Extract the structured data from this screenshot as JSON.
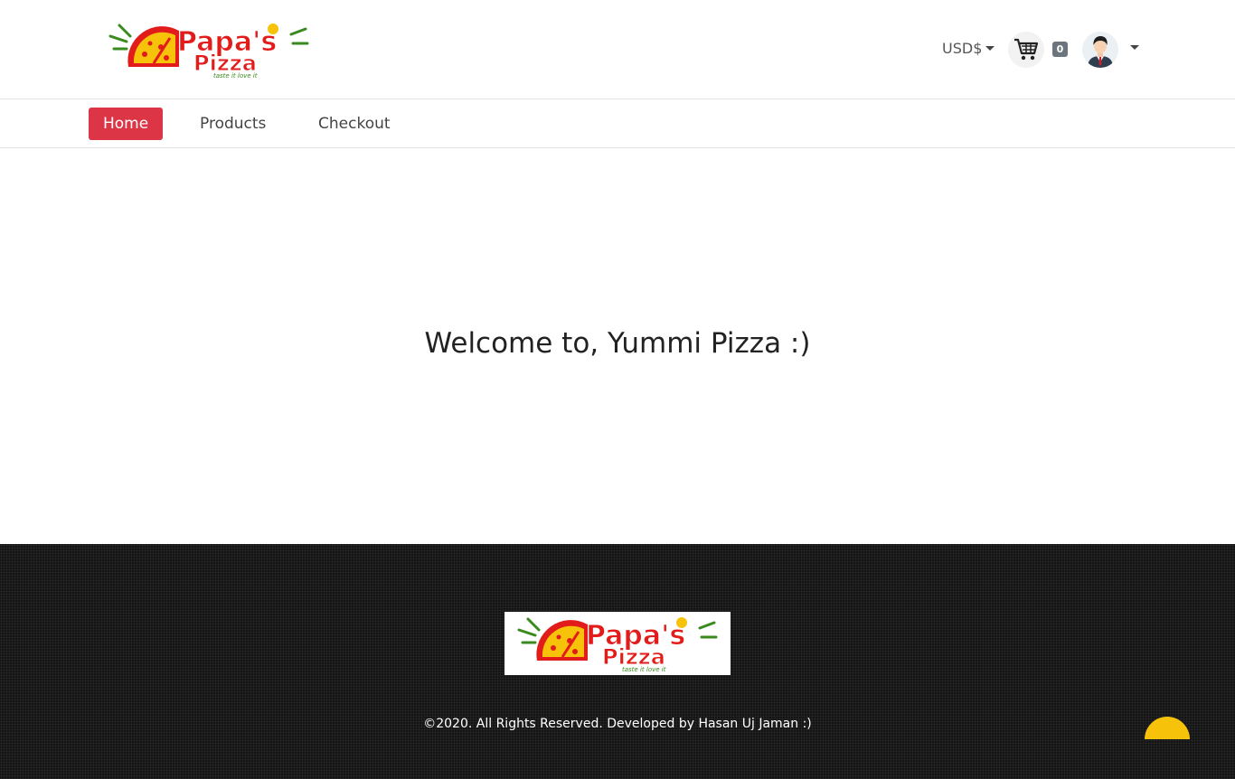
{
  "header": {
    "logo_alt": "Papa's Pizza",
    "logo_text_top": "Papa's",
    "logo_text_bottom": "Pizza",
    "logo_tagline": "taste it love it",
    "currency_label": "USD$",
    "cart_count": "0"
  },
  "nav": {
    "items": [
      {
        "label": "Home",
        "active": true
      },
      {
        "label": "Products",
        "active": false
      },
      {
        "label": "Checkout",
        "active": false
      }
    ]
  },
  "main": {
    "welcome_text": "Welcome to, Yummi Pizza :)"
  },
  "footer": {
    "copyright": "©2020. All Rights Reserved. Developed by Hasan Uj Jaman :)"
  },
  "colors": {
    "accent_red": "#dc3545",
    "brand_yellow": "#f7c20a",
    "footer_bg": "#141414"
  }
}
